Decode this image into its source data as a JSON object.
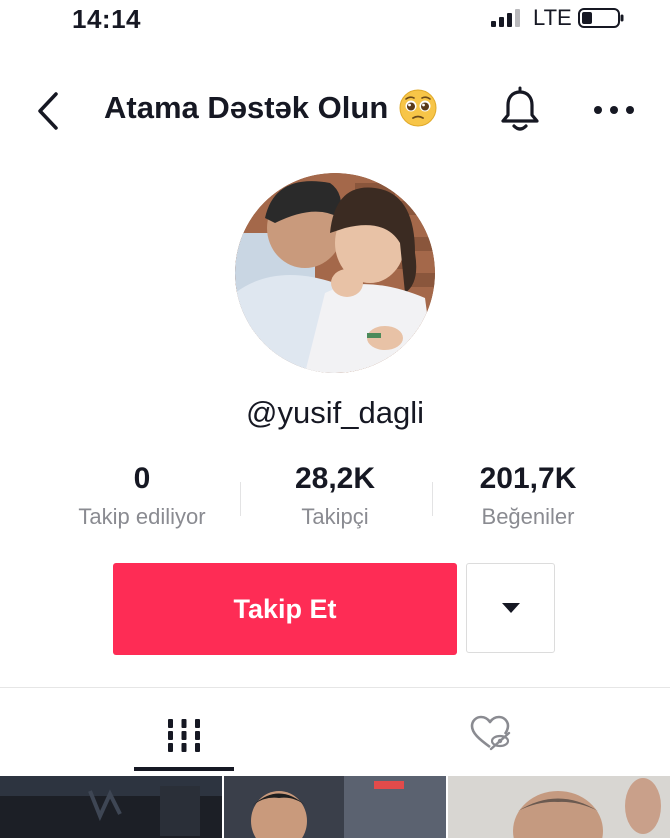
{
  "status_bar": {
    "time": "14:14",
    "network": "LTE",
    "signal_icon": "signal-bars-icon",
    "battery_icon": "battery-icon"
  },
  "header": {
    "title": "Atama Dəstək Olun",
    "title_emoji": "pleading-face-emoji-icon",
    "back_icon": "chevron-left-icon",
    "bell_icon": "bell-icon",
    "more_icon": "ellipsis-icon"
  },
  "profile": {
    "username": "@yusif_dagli",
    "stats": [
      {
        "value": "0",
        "label": "Takip ediliyor"
      },
      {
        "value": "28,2K",
        "label": "Takipçi"
      },
      {
        "value": "201,7K",
        "label": "Beğeniler"
      }
    ],
    "follow_label": "Takip Et",
    "dropdown_icon": "caret-down-icon"
  },
  "tabs": [
    {
      "icon": "videos-grid-icon",
      "active": true
    },
    {
      "icon": "liked-hidden-heart-icon",
      "active": false
    }
  ],
  "colors": {
    "accent": "#fe2c55",
    "text": "#161823",
    "muted": "#8a8b91"
  }
}
